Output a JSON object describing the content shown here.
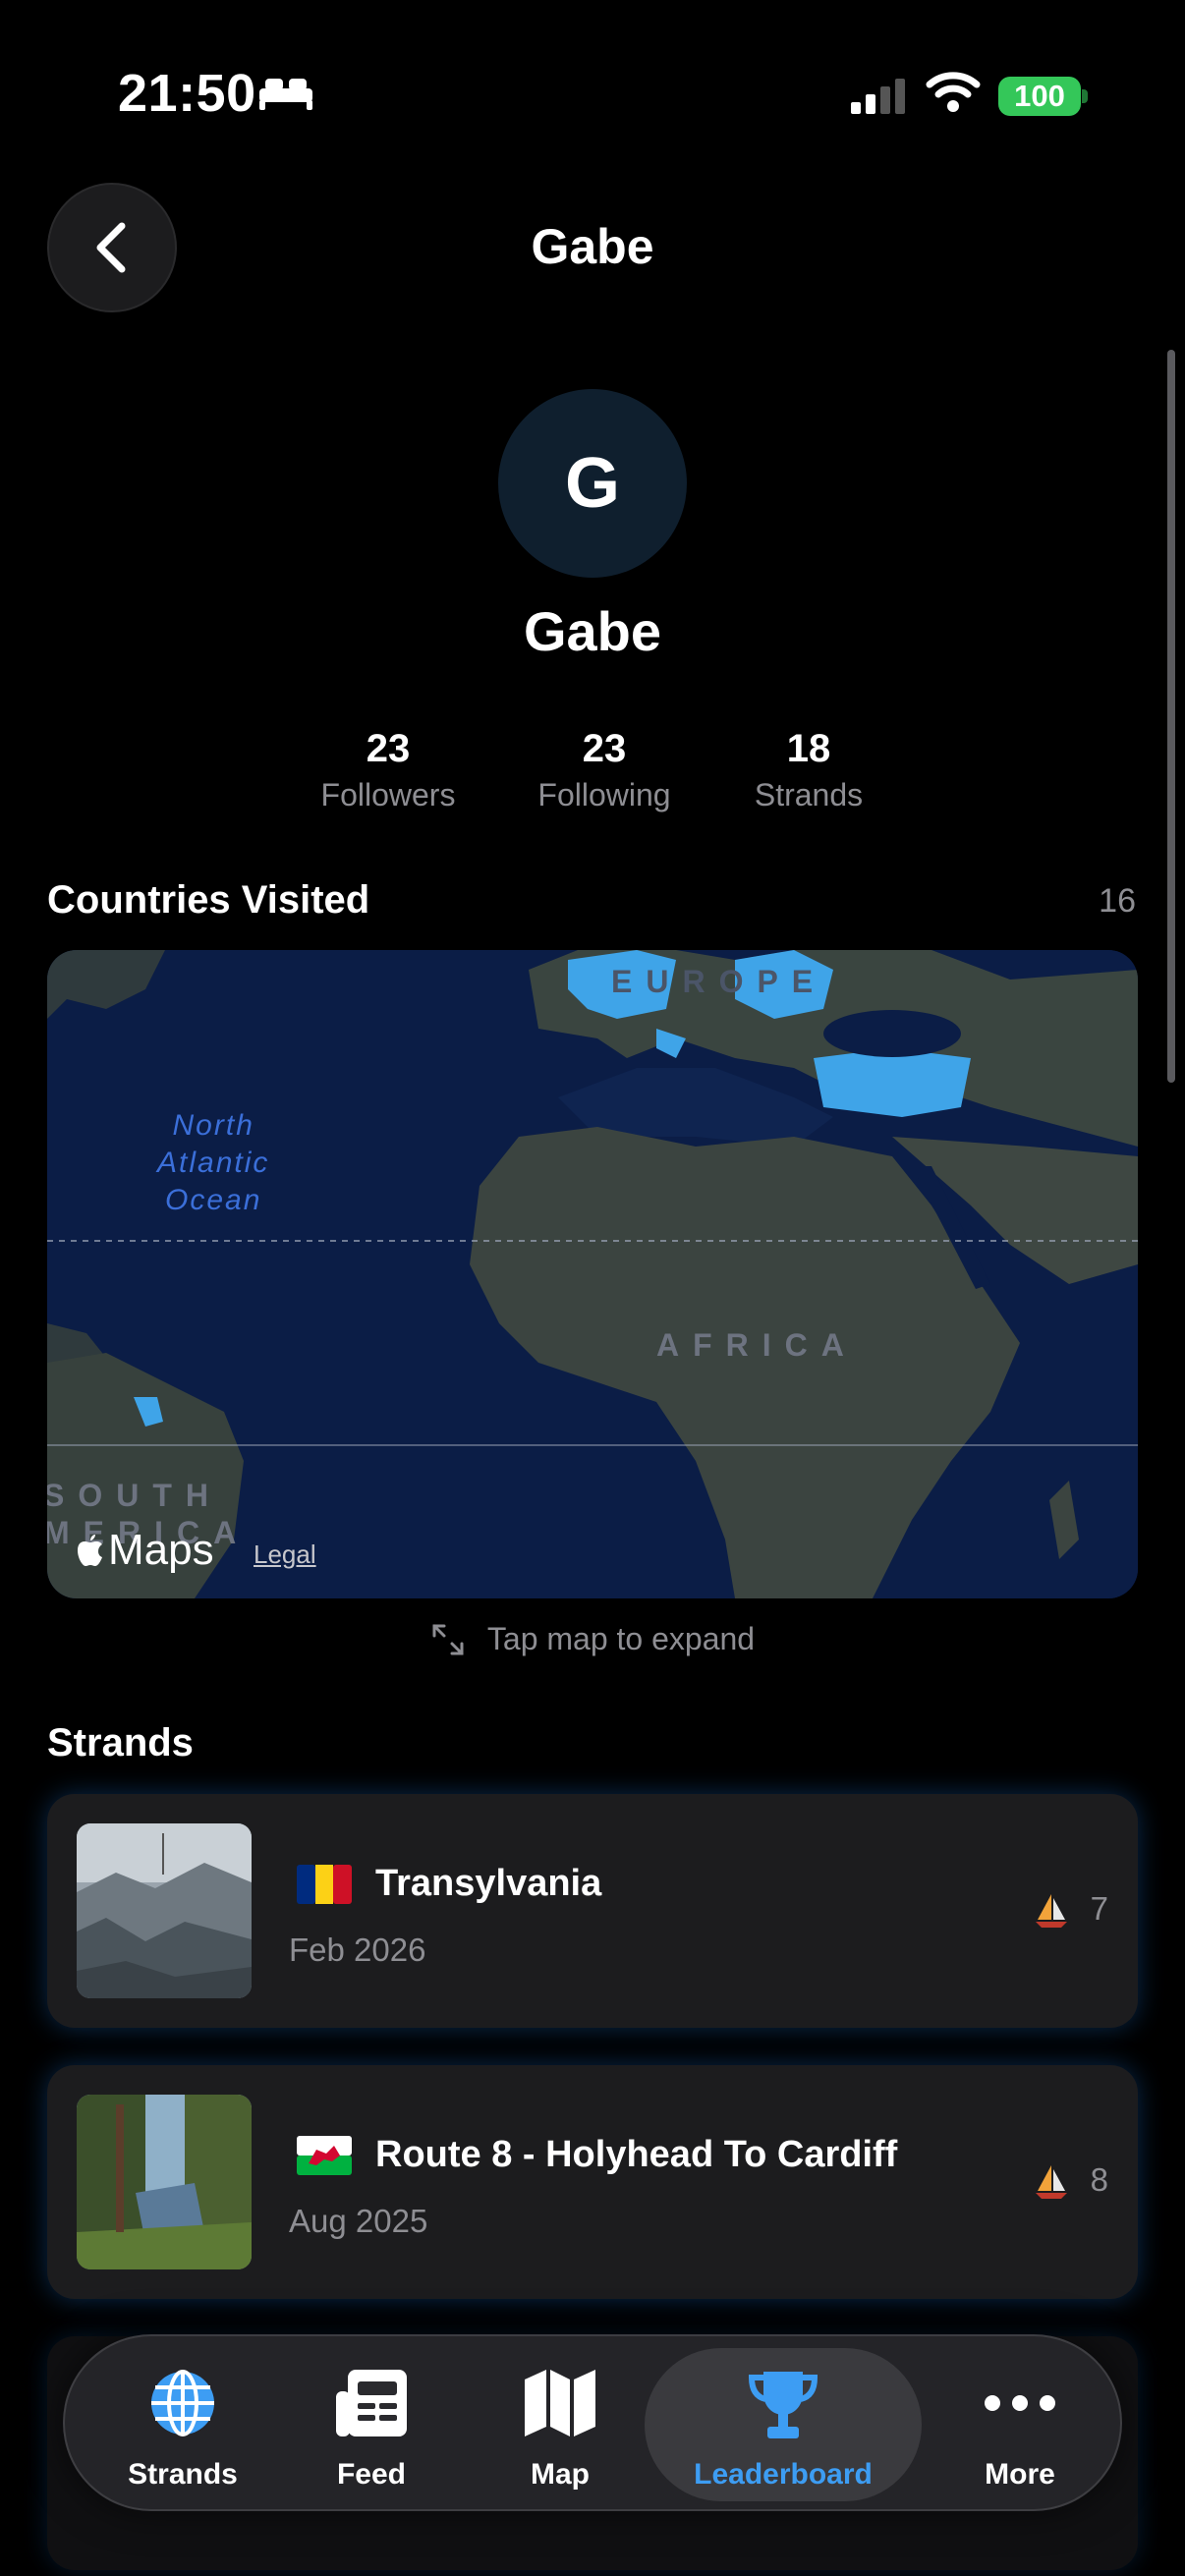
{
  "status_bar": {
    "time": "21:50",
    "battery": "100",
    "battery_color": "#34c759"
  },
  "header": {
    "title": "Gabe",
    "back_icon": "chevron-left-icon"
  },
  "profile": {
    "avatar_initial": "G",
    "name": "Gabe",
    "stats": {
      "followers_value": "23",
      "followers_label": "Followers",
      "following_value": "23",
      "following_label": "Following",
      "strands_value": "18",
      "strands_label": "Strands"
    }
  },
  "countries": {
    "title": "Countries Visited",
    "count": "16",
    "map": {
      "ocean_label": "North\nAtlantic\nOcean",
      "europe_label": "EUROPE",
      "africa_label": "AFRICA",
      "south_america_label": "SOUTH\nAMERICA",
      "brand": "Maps",
      "legal": "Legal"
    },
    "expand_hint": "Tap map to expand",
    "highlight_color": "#3fa4e8"
  },
  "strands": {
    "title": "Strands",
    "items": [
      {
        "flag": "romania-flag-icon",
        "title": "Transylvania",
        "date": "Feb 2026",
        "icon": "sailboat-icon",
        "count": "7"
      },
      {
        "flag": "wales-flag-icon",
        "title": "Route 8 - Holyhead To Cardiff",
        "date": "Aug 2025",
        "icon": "sailboat-icon",
        "count": "8"
      }
    ]
  },
  "tab_bar": {
    "tabs": [
      {
        "label": "Strands",
        "icon": "globe-icon"
      },
      {
        "label": "Feed",
        "icon": "newspaper-icon"
      },
      {
        "label": "Map",
        "icon": "map-icon"
      },
      {
        "label": "Leaderboard",
        "icon": "trophy-icon",
        "active": true
      },
      {
        "label": "More",
        "icon": "ellipsis-icon"
      }
    ],
    "active_color": "#3d9df3"
  }
}
